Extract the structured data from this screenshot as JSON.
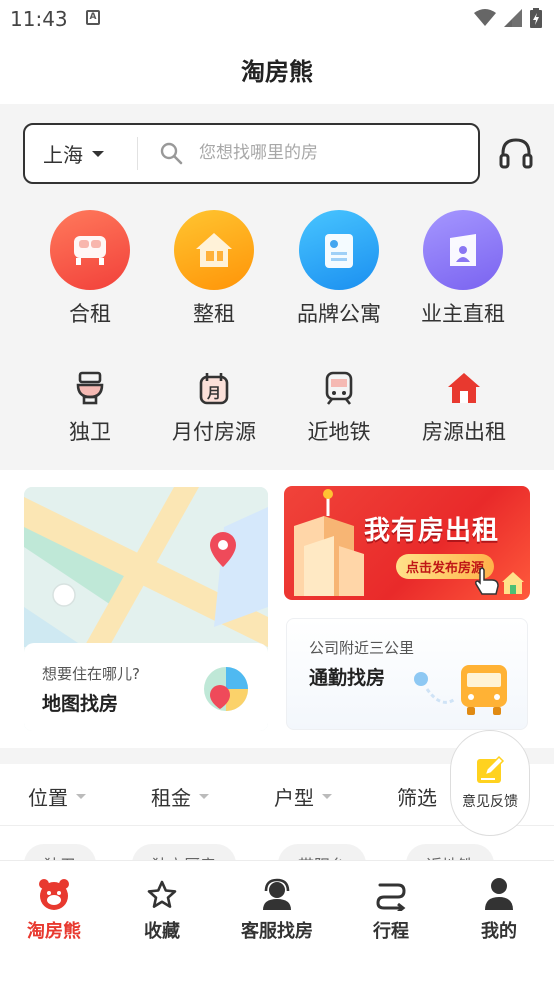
{
  "status_bar": {
    "time": "11:43",
    "notif_badge": "A"
  },
  "app": {
    "title": "淘房熊"
  },
  "search": {
    "city": "上海",
    "placeholder": "您想找哪里的房"
  },
  "main_categories": [
    {
      "label": "合租",
      "icon": "bed-icon",
      "color": "#f65a4a"
    },
    {
      "label": "整租",
      "icon": "house-icon",
      "color": "#ffa418"
    },
    {
      "label": "品牌公寓",
      "icon": "apartment-icon",
      "color": "#1fa5f4"
    },
    {
      "label": "业主直租",
      "icon": "owner-icon",
      "color": "#8e7bf4"
    }
  ],
  "sub_categories": [
    {
      "label": "独卫",
      "icon": "toilet-icon"
    },
    {
      "label": "月付房源",
      "icon": "monthly-pay-icon"
    },
    {
      "label": "近地铁",
      "icon": "subway-icon"
    },
    {
      "label": "房源出租",
      "icon": "home-rent-icon"
    }
  ],
  "map_card": {
    "question": "想要住在哪儿?",
    "heading": "地图找房"
  },
  "promo_banner": {
    "headline": "我有房出租",
    "cta": "点击发布房源"
  },
  "commute_card": {
    "question": "公司附近三公里",
    "heading": "通勤找房"
  },
  "filters": [
    "位置",
    "租金",
    "户型",
    "筛选"
  ],
  "tags": [
    "独卫",
    "独立厨房",
    "带阳台",
    "近地铁"
  ],
  "feedback": {
    "label": "意见反馈"
  },
  "bottom_nav": [
    {
      "label": "淘房熊",
      "icon": "bear-icon",
      "active": true
    },
    {
      "label": "收藏",
      "icon": "star-icon",
      "active": false
    },
    {
      "label": "客服找房",
      "icon": "service-agent-icon",
      "active": false
    },
    {
      "label": "行程",
      "icon": "route-icon",
      "active": false
    },
    {
      "label": "我的",
      "icon": "user-icon",
      "active": false
    }
  ],
  "colors": {
    "accent": "#e8392f",
    "text": "#222222",
    "background": "#f4f4f4"
  }
}
